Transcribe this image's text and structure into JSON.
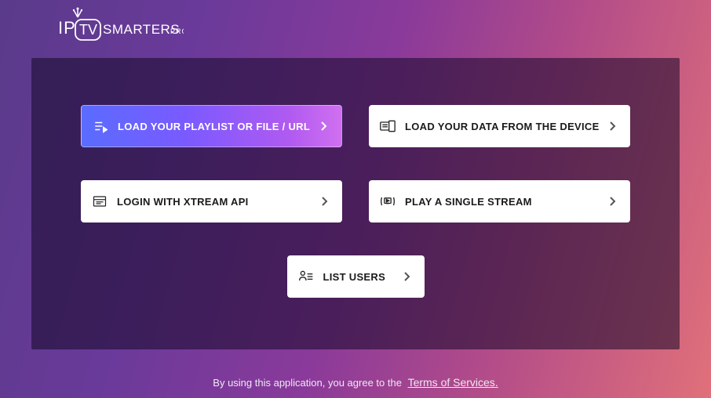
{
  "brand": {
    "name": "IPTV SMARTERS PRO"
  },
  "options": {
    "playlist": "LOAD YOUR PLAYLIST OR FILE / URL",
    "device": "LOAD YOUR DATA FROM THE DEVICE",
    "xtream": "LOGIN WITH XTREAM API",
    "single": "PLAY A SINGLE STREAM",
    "users": "LIST USERS"
  },
  "footer": {
    "text": "By using this application, you agree to the",
    "terms": "Terms of Services."
  }
}
